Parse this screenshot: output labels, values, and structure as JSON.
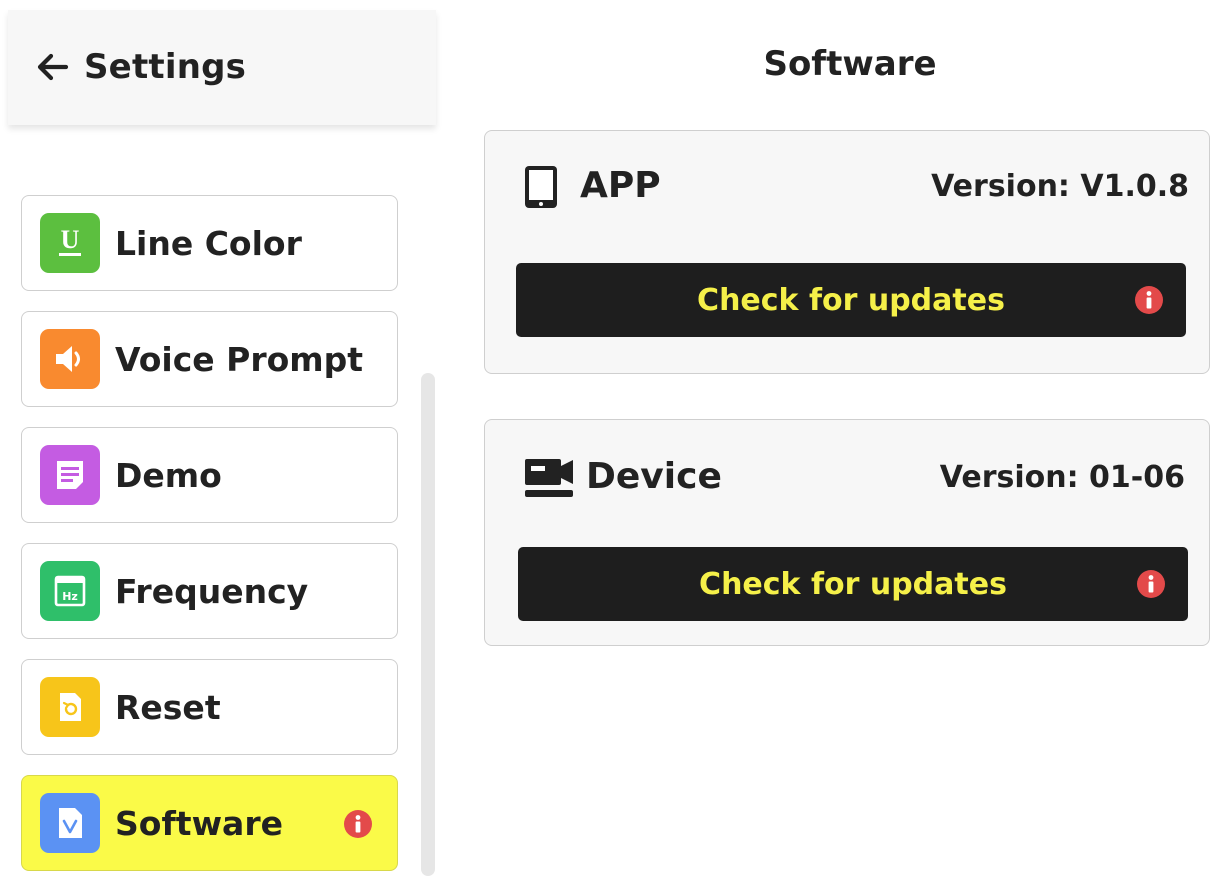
{
  "header": {
    "back_label": "Settings",
    "title": "Software"
  },
  "menu": {
    "items": [
      {
        "label": "Line Color",
        "icon": "underline-icon",
        "color": "#5cbf3f"
      },
      {
        "label": "Voice Prompt",
        "icon": "speaker-icon",
        "color": "#f98a2f"
      },
      {
        "label": "Demo",
        "icon": "document-icon",
        "color": "#c45ce2"
      },
      {
        "label": "Frequency",
        "icon": "frequency-hz-icon",
        "color": "#2fbf6a"
      },
      {
        "label": "Reset",
        "icon": "reset-icon",
        "color": "#f7c51a"
      },
      {
        "label": "Software",
        "icon": "software-icon",
        "color": "#5b92f3",
        "active": true,
        "badge": "i"
      }
    ]
  },
  "cards": {
    "app": {
      "name": "APP",
      "version": "Version: V1.0.8",
      "button_label": "Check for updates",
      "badge": "i"
    },
    "device": {
      "name": "Device",
      "version": "Version: 01-06",
      "button_label": "Check for updates",
      "badge": "i"
    }
  },
  "colors": {
    "active_item": "#fafa48",
    "button_bg": "#1e1e1e",
    "button_text": "#f5f049",
    "badge": "#e34a4a"
  }
}
